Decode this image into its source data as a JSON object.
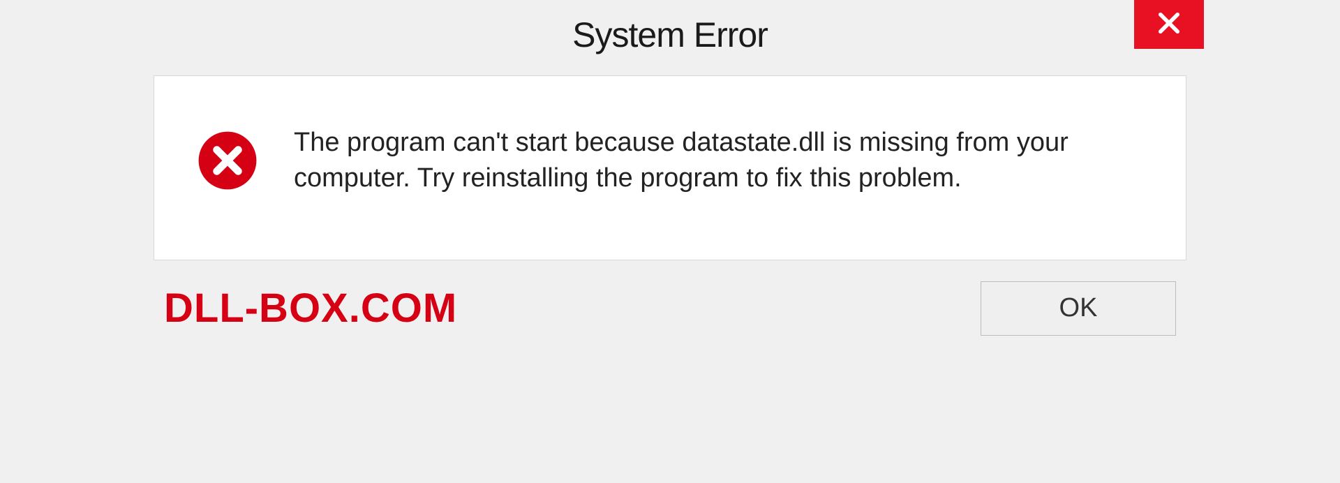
{
  "dialog": {
    "title": "System Error",
    "message": "The program can't start because datastate.dll is missing from your computer. Try reinstalling the program to fix this problem.",
    "ok_label": "OK"
  },
  "watermark": "DLL-BOX.COM",
  "colors": {
    "close_bg": "#e81123",
    "error_icon": "#d60015",
    "watermark": "#d60015"
  },
  "icons": {
    "close": "close-icon",
    "error": "error-circle-x-icon"
  }
}
